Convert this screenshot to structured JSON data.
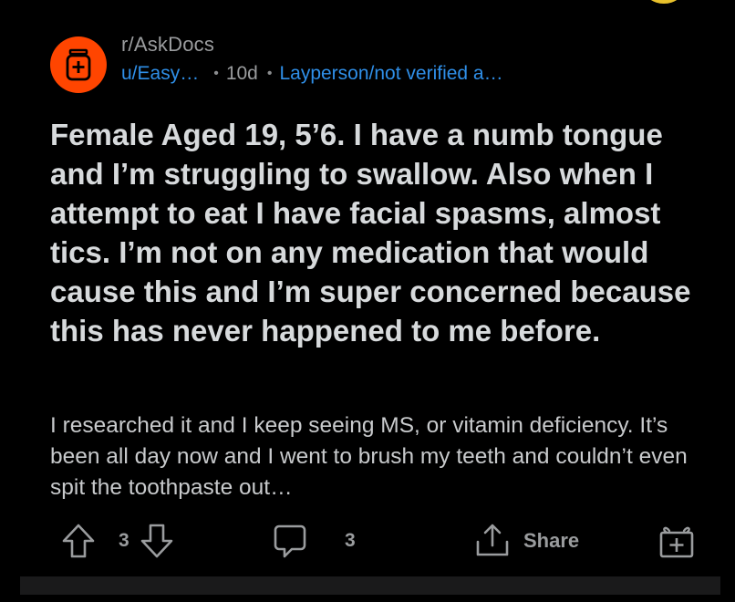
{
  "post": {
    "subreddit": "r/AskDocs",
    "author": "u/Easy…",
    "age": "10d",
    "flair": "Layperson/not verified a…",
    "title": "Female Aged 19, 5’6. I have a numb tongue and I’m struggling to swallow. Also when I attempt to eat I have facial spasms, almost tics. I’m not on any medication that would cause this and I’m super concerned because this has never happened to me before.",
    "body": "I researched it and I keep seeing MS, or vitamin deficiency. It’s been all day now and I went to brush my teeth and couldn’t even spit the toothpaste out…"
  },
  "actions": {
    "vote_count": "3",
    "comment_count": "3",
    "share_label": "Share"
  },
  "icons": {
    "subreddit": "askdocs-medicine-icon",
    "upvote": "arrow-up-icon",
    "downvote": "arrow-down-icon",
    "comment": "comment-bubble-icon",
    "share": "share-icon",
    "award": "award-gift-icon"
  },
  "colors": {
    "background": "#000000",
    "subreddit_icon": "#ff4500",
    "link_blue": "#2f8fe8",
    "title_text": "#d7dadc",
    "muted_text": "#9a9c9e"
  }
}
